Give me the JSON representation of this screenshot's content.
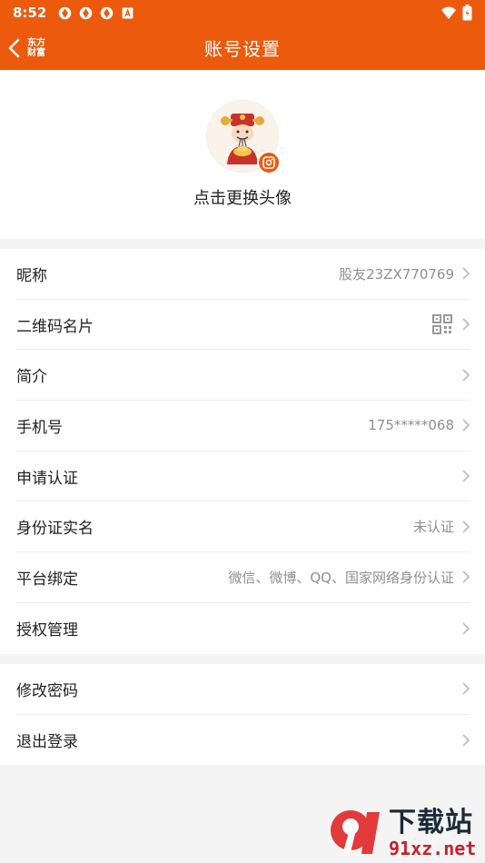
{
  "status_bar": {
    "time": "8:52"
  },
  "header": {
    "title": "账号设置",
    "brand_line1": "东方",
    "brand_line2": "财富"
  },
  "avatar": {
    "hint": "点击更换头像"
  },
  "settings_group_1": [
    {
      "label": "昵称",
      "value": "股友23ZX770769"
    },
    {
      "label": "二维码名片",
      "value": ""
    },
    {
      "label": "简介",
      "value": ""
    },
    {
      "label": "手机号",
      "value": "175*****068"
    },
    {
      "label": "申请认证",
      "value": ""
    },
    {
      "label": "身份证实名",
      "value": "未认证"
    },
    {
      "label": "平台绑定",
      "value": "微信、微博、QQ、国家网络身份认证"
    },
    {
      "label": "授权管理",
      "value": ""
    }
  ],
  "settings_group_2": [
    {
      "label": "修改密码"
    },
    {
      "label": "退出登录"
    }
  ],
  "watermark": {
    "text": "下载站",
    "url": "91xz.net"
  },
  "colors": {
    "accent": "#ec5a0e",
    "text": "#222222",
    "secondary": "#8f8f8f",
    "background": "#f4f4f4"
  }
}
